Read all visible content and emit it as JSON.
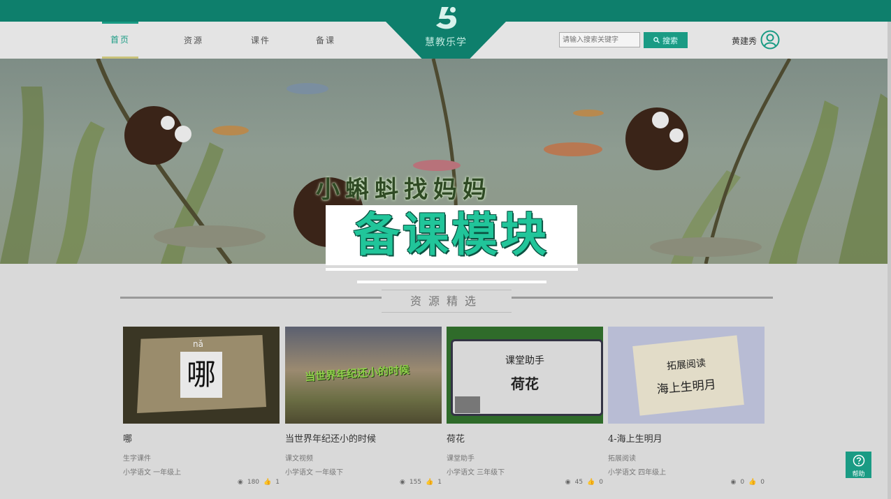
{
  "nav": {
    "items": [
      "首页",
      "资源",
      "课件",
      "备课"
    ],
    "logo_text": "慧教乐学",
    "search_placeholder": "请输入搜索关键字",
    "search_label": "搜索",
    "username": "黄建秀"
  },
  "banner": {
    "title": "小蝌蚪找妈妈"
  },
  "overlay": {
    "text": "备课模块"
  },
  "section": {
    "title": "资源精选"
  },
  "cards": [
    {
      "thumb_char": "哪",
      "thumb_pinyin": "nǎ",
      "title": "哪",
      "type": "生字课件",
      "grade": "小学语文 一年级上",
      "views": "180",
      "likes": "1"
    },
    {
      "thumb_caption": "当世界年纪还小的时候",
      "title": "当世界年纪还小的时候",
      "type": "课文视频",
      "grade": "小学语文 一年级下",
      "views": "155",
      "likes": "1"
    },
    {
      "thumb_header": "课堂助手",
      "thumb_caption": "荷花",
      "title": "荷花",
      "type": "课堂助手",
      "grade": "小学语文 三年级下",
      "views": "45",
      "likes": "0"
    },
    {
      "thumb_header": "拓展阅读",
      "thumb_caption": "海上生明月",
      "title": "4-海上生明月",
      "type": "拓展阅读",
      "grade": "小学语文 四年级上",
      "views": "0",
      "likes": "0"
    }
  ],
  "help": {
    "label": "帮助"
  },
  "colors": {
    "brand": "#0e7f6c",
    "accent": "#1a9b84",
    "overlay_text": "#21c59a"
  }
}
